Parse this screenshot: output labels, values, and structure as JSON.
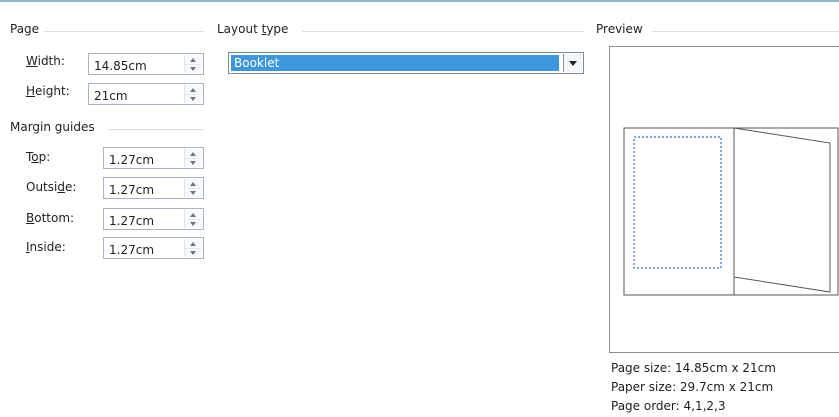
{
  "page_group": {
    "title": "Page",
    "width": {
      "prefix": "",
      "accel": "W",
      "suffix": "idth:",
      "value": "14.85cm"
    },
    "height": {
      "prefix": "",
      "accel": "H",
      "suffix": "eight:",
      "value": "21cm"
    }
  },
  "margin_group": {
    "title": "Margin guides",
    "top": {
      "prefix": "T",
      "accel": "o",
      "suffix": "p:",
      "value": "1.27cm"
    },
    "outside": {
      "prefix": "Outsi",
      "accel": "d",
      "suffix": "e:",
      "value": "1.27cm"
    },
    "bottom": {
      "prefix": "",
      "accel": "B",
      "suffix": "ottom:",
      "value": "1.27cm"
    },
    "inside": {
      "prefix": "",
      "accel": "I",
      "suffix": "nside:",
      "value": "1.27cm"
    }
  },
  "layout_group": {
    "title_prefix": "Layout ",
    "title_accel": "t",
    "title_suffix": "ype",
    "selected": "Booklet"
  },
  "preview_group": {
    "title": "Preview",
    "page_size": "Page size: 14.85cm x 21cm",
    "paper_size": "Paper size: 29.7cm x 21cm",
    "page_order": "Page order: 4,1,2,3"
  },
  "colors": {
    "selection": "#3d97df",
    "margin_guide": "#2b6fd6",
    "top_rule": "#8fb8cf"
  }
}
